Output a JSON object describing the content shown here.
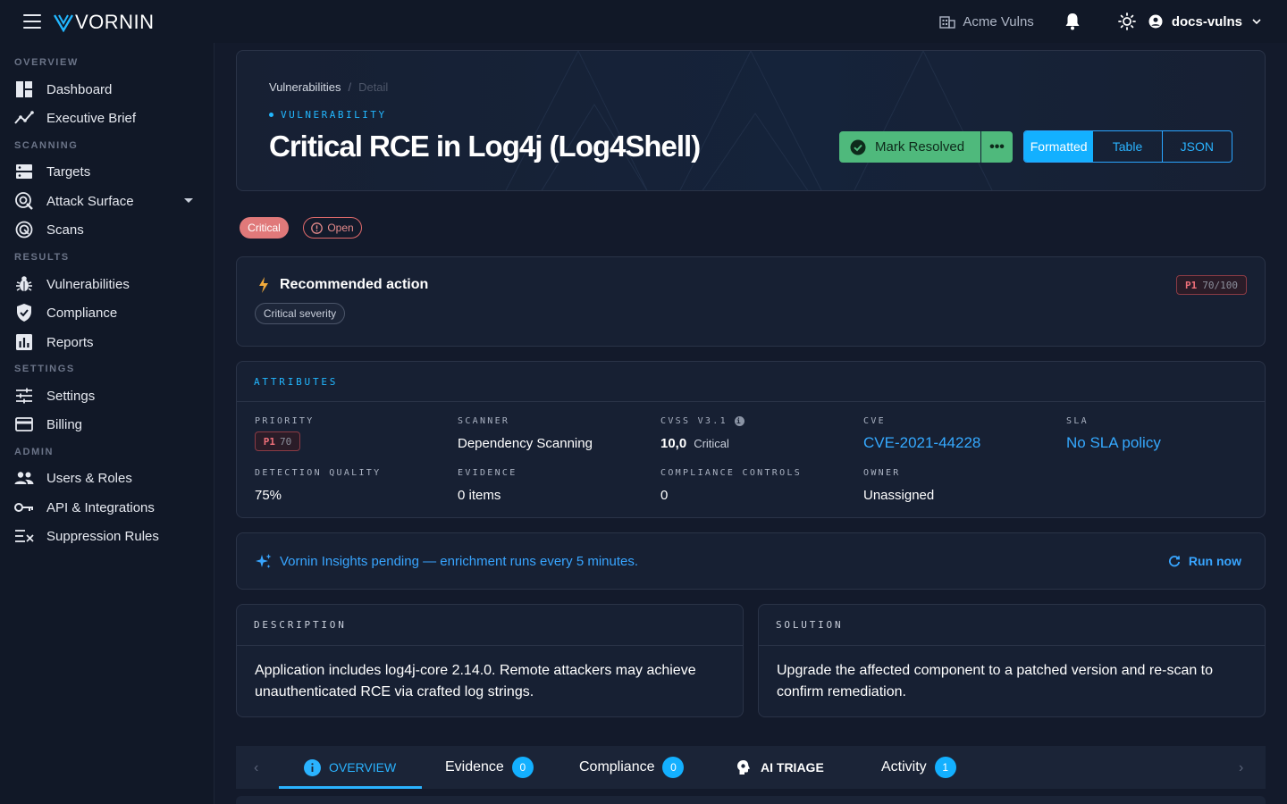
{
  "topbar": {
    "brand": "VORNIN",
    "org": "Acme Vulns",
    "user": "docs-vulns"
  },
  "sidebar": {
    "sections": [
      {
        "label": "OVERVIEW"
      },
      {
        "label": "SCANNING"
      },
      {
        "label": "RESULTS"
      },
      {
        "label": "SETTINGS"
      },
      {
        "label": "ADMIN"
      }
    ],
    "items": [
      {
        "label": "Dashboard",
        "icon": "dashboard-icon"
      },
      {
        "label": "Executive Brief",
        "icon": "trend-icon"
      },
      {
        "label": "Targets",
        "icon": "server-icon"
      },
      {
        "label": "Attack Surface",
        "icon": "radar-search-icon"
      },
      {
        "label": "Scans",
        "icon": "scan-icon"
      },
      {
        "label": "Vulnerabilities",
        "icon": "bug-icon"
      },
      {
        "label": "Compliance",
        "icon": "shield-check-icon"
      },
      {
        "label": "Reports",
        "icon": "chart-icon"
      },
      {
        "label": "Settings",
        "icon": "sliders-icon"
      },
      {
        "label": "Billing",
        "icon": "card-icon"
      },
      {
        "label": "Users & Roles",
        "icon": "users-icon"
      },
      {
        "label": "API & Integrations",
        "icon": "key-icon"
      },
      {
        "label": "Suppression Rules",
        "icon": "suppress-icon"
      }
    ]
  },
  "hero": {
    "breadcrumb_root": "Vulnerabilities",
    "breadcrumb_sep": "/",
    "breadcrumb_current": "Detail",
    "eyebrow": "VULNERABILITY",
    "title": "Critical RCE in Log4j (Log4Shell)",
    "resolve_label": "Mark Resolved",
    "more_label": "•••",
    "view_modes": [
      "Formatted",
      "Table",
      "JSON"
    ],
    "active_view": "Formatted"
  },
  "status": {
    "severity": "Critical",
    "state": "Open"
  },
  "recommended": {
    "title": "Recommended action",
    "chip": "Critical severity",
    "score_priority": "P1",
    "score_value": "70/100"
  },
  "attributes": {
    "heading": "ATTRIBUTES",
    "priority_label": "PRIORITY",
    "priority_p": "P1",
    "priority_n": "70",
    "scanner_label": "SCANNER",
    "scanner": "Dependency Scanning",
    "cvss_label": "CVSS V3.1",
    "cvss_score": "10,0",
    "cvss_rating": "Critical",
    "cve_label": "CVE",
    "cve": "CVE-2021-44228",
    "sla_label": "SLA",
    "sla": "No SLA policy",
    "detection_label": "DETECTION QUALITY",
    "detection": "75%",
    "evidence_label": "EVIDENCE",
    "evidence": "0 items",
    "controls_label": "COMPLIANCE CONTROLS",
    "controls": "0",
    "owner_label": "OWNER",
    "owner": "Unassigned"
  },
  "insights": {
    "text": "Vornin Insights pending — enrichment runs every 5 minutes.",
    "action": "Run now"
  },
  "description": {
    "heading": "DESCRIPTION",
    "text": "Application includes log4j-core 2.14.0. Remote attackers may achieve unauthenticated RCE via crafted log strings."
  },
  "solution": {
    "heading": "SOLUTION",
    "text": "Upgrade the affected component to a patched version and re-scan to confirm remediation."
  },
  "tabs": [
    {
      "label": "OVERVIEW",
      "badge": ""
    },
    {
      "label": "Evidence",
      "badge": "0"
    },
    {
      "label": "Compliance",
      "badge": "0"
    },
    {
      "label": "AI TRIAGE",
      "badge": ""
    },
    {
      "label": "Activity",
      "badge": "1"
    }
  ],
  "colors": {
    "accent": "#13b0ff",
    "success": "#4fb97c",
    "critical": "#e0797a",
    "background": "#131a2b"
  }
}
